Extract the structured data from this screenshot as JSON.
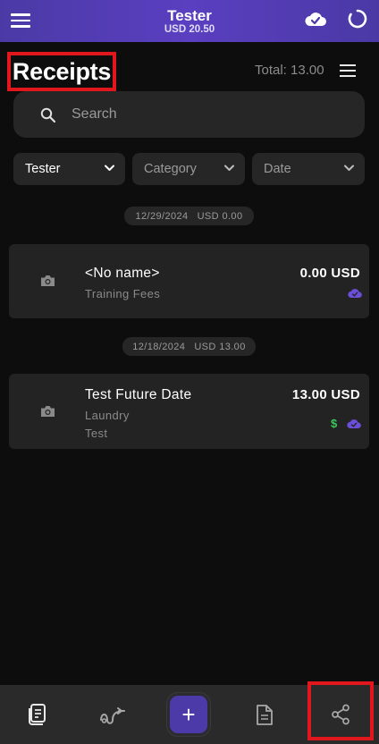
{
  "header": {
    "title": "Tester",
    "subtitle": "USD 20.50",
    "menu_icon": "menu-icon",
    "cloud_icon": "cloud-check-icon",
    "sync_icon": "sync-icon"
  },
  "page": {
    "title": "Receipts",
    "total": "Total: 13.00"
  },
  "search": {
    "placeholder": "Search"
  },
  "filters": {
    "user": "Tester",
    "category": "Category",
    "date": "Date"
  },
  "groups": [
    {
      "date": "12/29/2024",
      "sum": "USD 0.00",
      "receipts": [
        {
          "name": "<No name>",
          "category": "Training Fees",
          "note": "",
          "amount": "0.00 USD"
        }
      ]
    },
    {
      "date": "12/18/2024",
      "sum": "USD 13.00",
      "receipts": [
        {
          "name": "Test Future Date",
          "category": "Laundry",
          "note": "Test",
          "amount": "13.00 USD",
          "paid_symbol": "$"
        }
      ]
    }
  ],
  "nav": {
    "add_symbol": "+",
    "items": [
      "receipt-icon",
      "trend-icon",
      "add-icon",
      "document-icon",
      "share-icon"
    ]
  },
  "colors": {
    "accent": "#4c3aa8",
    "header_gradient_start": "#4b3aa6",
    "highlight": "#e0181e",
    "paid_green": "#3cc85a",
    "synced_purple": "#6b4fd8"
  }
}
